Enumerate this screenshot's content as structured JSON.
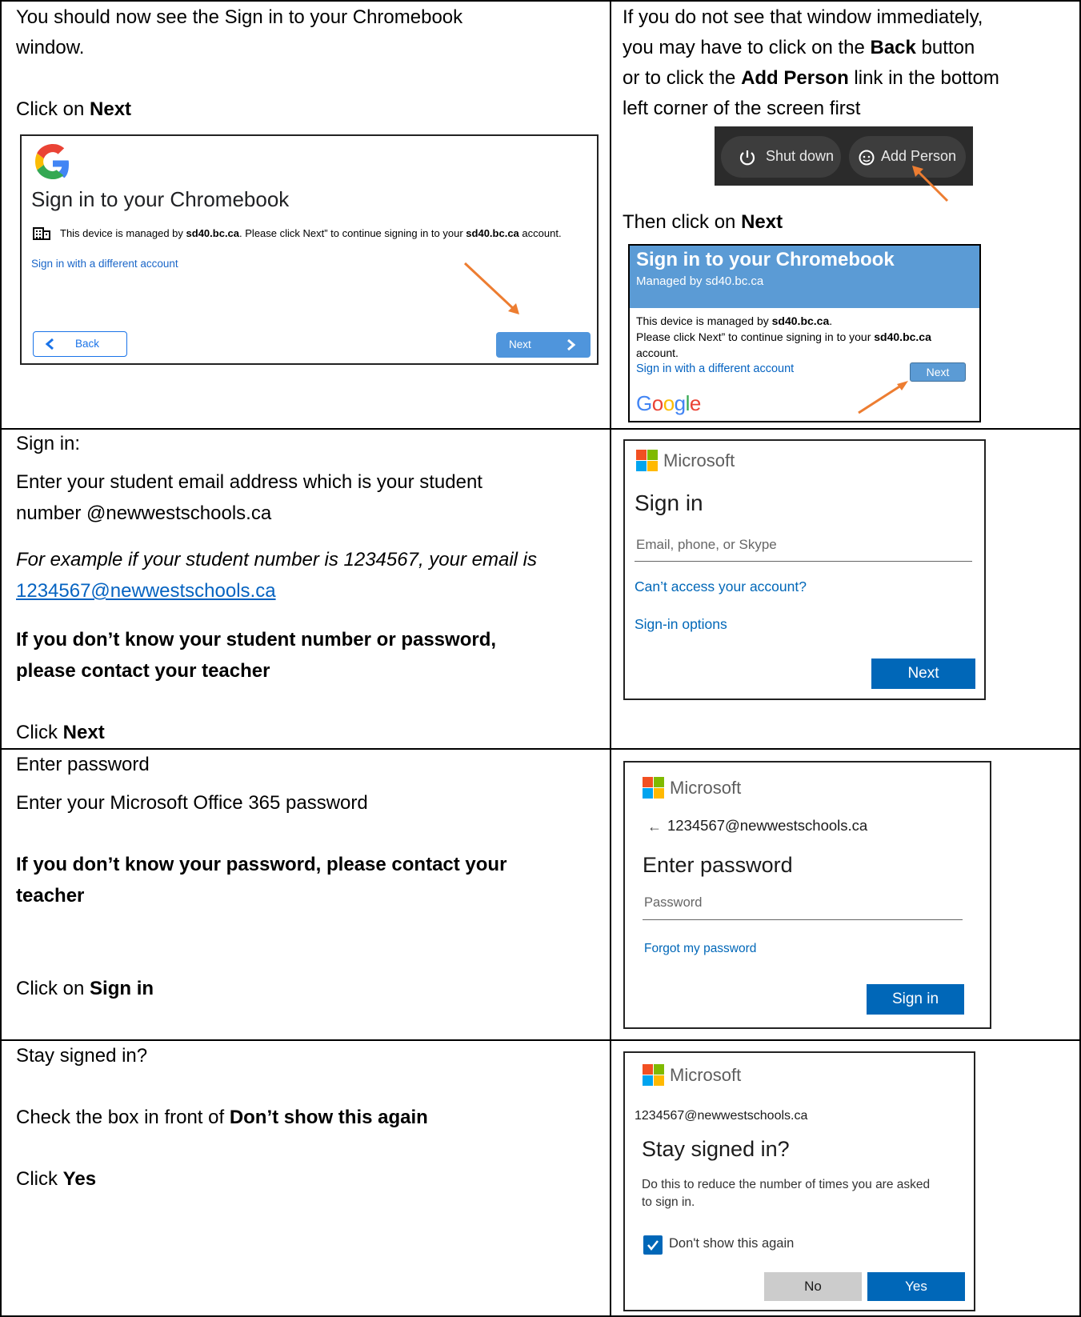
{
  "row1": {
    "left": {
      "line1": "You should now see the Sign in to your Chromebook",
      "line2": "window.",
      "click_prefix": "Click on ",
      "click_bold": "Next"
    },
    "shot1": {
      "title": "Sign in to your Chromebook",
      "managed_pre": "This device is managed by ",
      "managed_domain1": "sd40.bc.ca",
      "managed_mid": ". Please click Next” to continue signing in to your ",
      "managed_domain2": "sd40.bc.ca",
      "managed_post": " account.",
      "different_account": "Sign in with a different account",
      "back_label": "Back",
      "next_label": "Next"
    },
    "right": {
      "line1": "If you do not see that window immediately,",
      "line2_pre": "you may have to click on the ",
      "line2_bold": "Back",
      "line2_post": " button",
      "line3_pre": "or to click the ",
      "line3_bold": "Add Person",
      "line3_post": " link in the bottom",
      "line4": "left corner of the screen first",
      "then_pre": "Then click on ",
      "then_bold": "Next"
    },
    "shelf": {
      "shutdown_label": "Shut down",
      "add_person_label": "Add Person"
    },
    "shot2": {
      "title": "Sign in to your Chromebook",
      "subtitle": "Managed by sd40.bc.ca",
      "line1_pre": "This device is managed by ",
      "line1_bold": "sd40.bc.ca",
      "line1_post": ".",
      "line2_pre": "Please click Next” to continue signing in to your ",
      "line2_bold": "sd40.bc.ca",
      "line3": "account.",
      "different_account": "Sign in with a different account",
      "next_label": "Next",
      "google_logo": "Google"
    }
  },
  "row2": {
    "left": {
      "heading": "Sign in:",
      "p1_line1": "Enter your student email address which is your student",
      "p1_line2": "number @newwestschools.ca",
      "example_line1": "For example if your student number is 1234567, your email is",
      "example_link": "1234567@newwestschools.ca",
      "bold_line1": "If you don’t know your student number or password,",
      "bold_line2": "please contact your teacher",
      "click_prefix": "Click ",
      "click_bold": "Next"
    },
    "shot": {
      "brand": "Microsoft",
      "title": "Sign in",
      "email_placeholder": "Email, phone, or Skype",
      "cant_access": "Can’t access your account?",
      "signin_options": "Sign-in options",
      "next_label": "Next"
    }
  },
  "row3": {
    "left": {
      "heading": "Enter password",
      "p1": "Enter your Microsoft Office 365 password",
      "bold_line1": "If you don’t know your password, please contact your",
      "bold_line2": "teacher",
      "click_prefix": "Click on ",
      "click_bold": "Sign in"
    },
    "shot": {
      "brand": "Microsoft",
      "back_arrow": "←",
      "email": "1234567@newwestschools.ca",
      "title": "Enter password",
      "password_placeholder": "Password",
      "forgot": "Forgot my password",
      "signin_label": "Sign in"
    }
  },
  "row4": {
    "left": {
      "heading": "Stay signed in?",
      "check_prefix": "Check the box in front of ",
      "check_bold": "Don’t show this again",
      "click_prefix": "Click ",
      "click_bold": "Yes"
    },
    "shot": {
      "brand": "Microsoft",
      "email": "1234567@newwestschools.ca",
      "title": "Stay signed in?",
      "desc_line1": "Do this to reduce the number of times you are asked",
      "desc_line2": "to sign in.",
      "checkbox_label": "Don't show this again",
      "checkbox_checked": true,
      "no_label": "No",
      "yes_label": "Yes"
    }
  },
  "colors": {
    "ms_blue": "#0067b8",
    "google_blue_header": "#5b9bd5",
    "link_blue": "#0563c1",
    "arrow_orange": "#ed7d31"
  }
}
